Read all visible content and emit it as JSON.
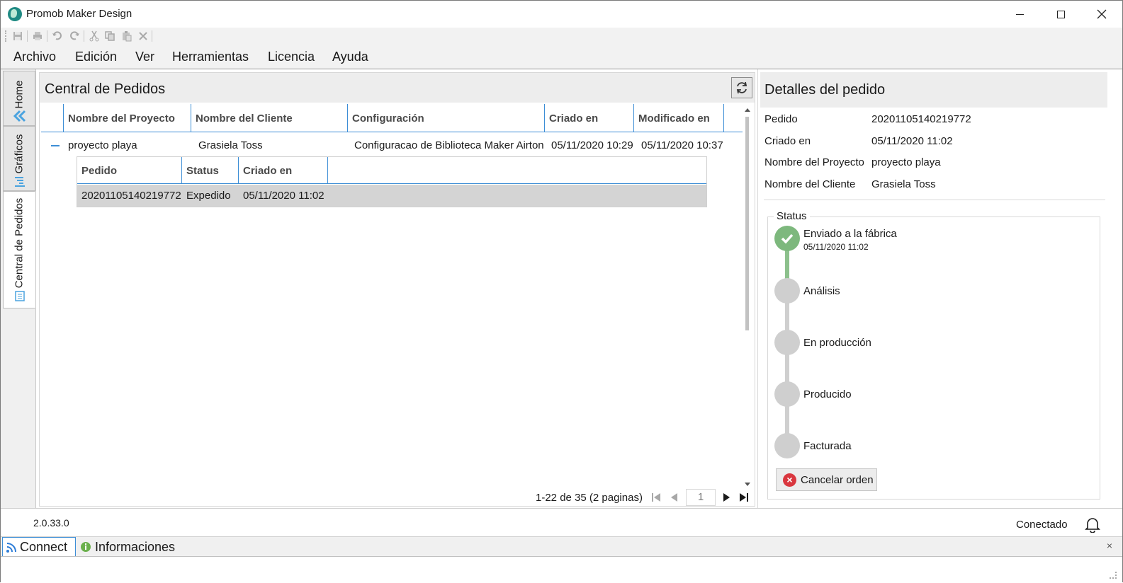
{
  "window": {
    "title": "Promob Maker Design"
  },
  "toolbar": {
    "icons": [
      "save-icon",
      "print-icon",
      "undo-icon",
      "redo-icon",
      "cut-icon",
      "copy-icon",
      "paste-icon",
      "delete-icon"
    ]
  },
  "menu": {
    "items": [
      "Archivo",
      "Edición",
      "Ver",
      "Herramientas",
      "Licencia",
      "Ayuda"
    ]
  },
  "side_tabs": {
    "home": "Home",
    "graficos": "Gráficos",
    "central": "Central de Pedidos"
  },
  "orders_panel": {
    "title": "Central de Pedidos",
    "columns": [
      "Nombre del Proyecto",
      "Nombre del Cliente",
      "Configuración",
      "Criado en",
      "Modificado en"
    ],
    "row": {
      "proyecto": "proyecto playa",
      "cliente": "Grasiela Toss",
      "configuracion": "Configuracao de Biblioteca Maker Airton",
      "criado": "05/11/2020 10:29",
      "modificado": "05/11/2020 10:37"
    },
    "sub_columns": [
      "Pedido",
      "Status",
      "Criado en"
    ],
    "sub_row": {
      "pedido": "20201105140219772",
      "status": "Expedido",
      "criado": "05/11/2020 11:02"
    },
    "pager": {
      "summary": "1-22 de 35 (2 paginas)",
      "page": "1"
    }
  },
  "details_panel": {
    "title": "Detalles del pedido",
    "fields": [
      {
        "label": "Pedido",
        "value": "20201105140219772"
      },
      {
        "label": "Criado en",
        "value": "05/11/2020 11:02"
      },
      {
        "label": "Nombre del Proyecto",
        "value": "proyecto playa"
      },
      {
        "label": "Nombre del Cliente",
        "value": "Grasiela Toss"
      }
    ],
    "status_legend": "Status",
    "steps": [
      {
        "label": "Enviado a la fábrica",
        "date": "05/11/2020 11:02",
        "done": true
      },
      {
        "label": "Análisis",
        "done": false
      },
      {
        "label": "En producción",
        "done": false
      },
      {
        "label": "Producido",
        "done": false
      },
      {
        "label": "Facturada",
        "done": false
      }
    ],
    "cancel_label": "Cancelar orden"
  },
  "statusbar": {
    "version": "2.0.33.0",
    "connection": "Conectado"
  },
  "dock": {
    "tabs": [
      "Connect",
      "Informaciones"
    ]
  },
  "colors": {
    "accent": "#3d8ed6",
    "done": "#7db87d",
    "pending": "#cfcfcf",
    "cancel": "#d9363e"
  }
}
